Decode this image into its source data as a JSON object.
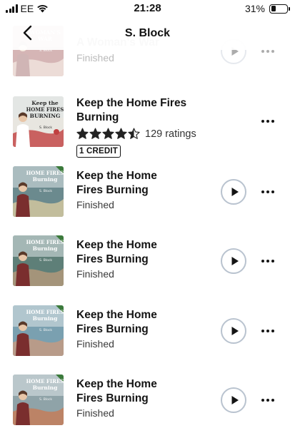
{
  "status_bar": {
    "carrier": "EE",
    "time": "21:28",
    "battery_percent": "31%",
    "battery_level": 0.31
  },
  "header": {
    "title": "S. Block",
    "back_icon": "chevron-left-icon"
  },
  "colors": {
    "play_ring": "#b9c3cf",
    "star": "#222222",
    "text": "#141414"
  },
  "books": [
    {
      "title_lines": [
        "A Woman's War"
      ],
      "status": "Finished",
      "cover": {
        "lines": [
          "WOMAN'S",
          "WAR"
        ],
        "author": "S. Block",
        "bg": "#8a2d2d",
        "accent": "#d9b8a6"
      }
    },
    {
      "title_lines": [
        "Keep the Home Fires Burning"
      ],
      "rating_value": 4.5,
      "rating_count": "129 ratings",
      "badge": "1 CREDIT",
      "cover": {
        "lines": [
          "Keep the",
          "HOME FIRES",
          "BURNING"
        ],
        "author": "S. Block",
        "bg": "#e8e6e0",
        "accent": "#c04040"
      }
    },
    {
      "title_lines": [
        "Keep the Home",
        "Fires Burning"
      ],
      "status": "Finished",
      "cover": {
        "lines": [
          "HOME FIRES",
          "Burning"
        ],
        "author": "S. Block",
        "bg": "#6b8a8e",
        "accent": "#d8c9a0"
      }
    },
    {
      "title_lines": [
        "Keep the Home",
        "Fires Burning"
      ],
      "status": "Finished",
      "cover": {
        "lines": [
          "HOME FIRES",
          "Burning"
        ],
        "author": "S. Block",
        "bg": "#5e7f78",
        "accent": "#b59a7a"
      }
    },
    {
      "title_lines": [
        "Keep the Home",
        "Fires Burning"
      ],
      "status": "Finished",
      "cover": {
        "lines": [
          "HOME FIRES",
          "Burning"
        ],
        "author": "S. Block",
        "bg": "#7aa0b0",
        "accent": "#c89a80"
      }
    },
    {
      "title_lines": [
        "Keep the Home",
        "Fires Burning"
      ],
      "status": "Finished",
      "cover": {
        "lines": [
          "HOME FIRES",
          "Burning"
        ],
        "author": "S. Block",
        "bg": "#8fa3a8",
        "accent": "#c77a55"
      }
    }
  ]
}
